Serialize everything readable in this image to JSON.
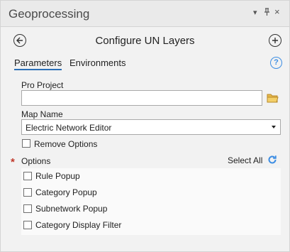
{
  "pane": {
    "title": "Geoprocessing",
    "controls": [
      "▾",
      "ᵖ",
      "×"
    ]
  },
  "header": {
    "title": "Configure UN Layers",
    "back_icon": "arrow-left-circle-icon",
    "add_icon": "plus-circle-icon"
  },
  "tabs": [
    {
      "label": "Parameters",
      "active": true
    },
    {
      "label": "Environments",
      "active": false
    }
  ],
  "help_icon": "?",
  "params": {
    "pro_project_label": "Pro Project",
    "pro_project_value": "",
    "map_name_label": "Map Name",
    "map_name_value": "Electric Network Editor",
    "remove_options_label": "Remove Options",
    "remove_options_checked": false,
    "options_required_marker": "*",
    "options_label": "Options",
    "select_all_label": "Select All",
    "options": [
      {
        "label": "Rule Popup",
        "checked": false
      },
      {
        "label": "Category Popup",
        "checked": false
      },
      {
        "label": "Subnetwork Popup",
        "checked": false
      },
      {
        "label": "Category Display Filter",
        "checked": false
      }
    ]
  },
  "colors": {
    "accent": "#2c6fb7",
    "help": "#3c8de3",
    "folder": "#e6b84a",
    "required": "#c0392b"
  }
}
